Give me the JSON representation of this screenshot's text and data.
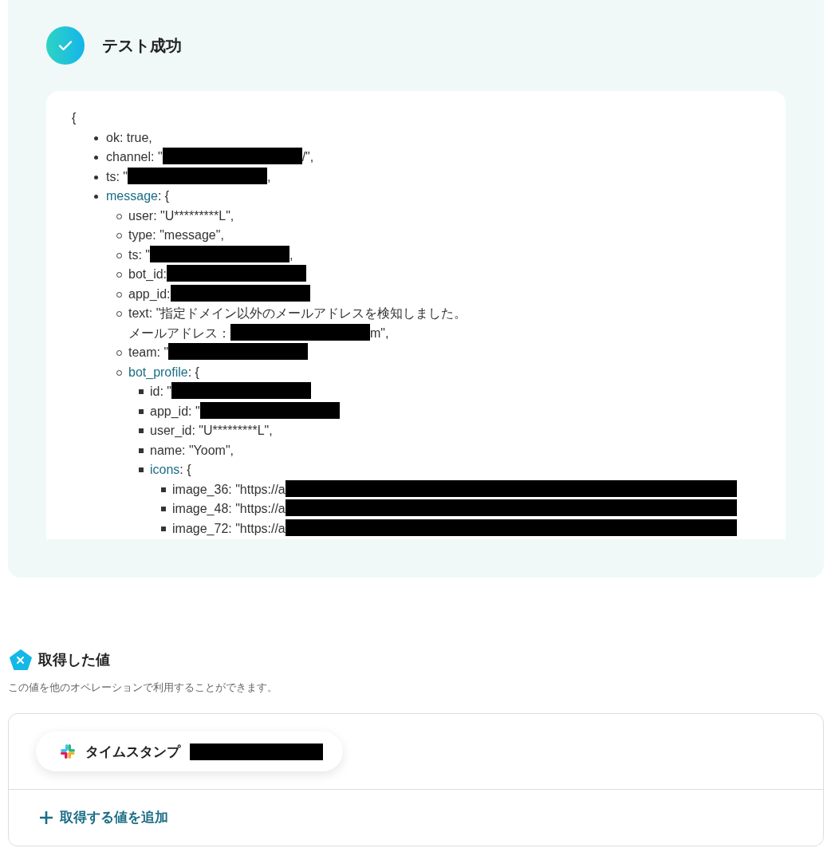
{
  "test_result": {
    "title": "テスト成功"
  },
  "response": {
    "open_brace": "{",
    "items": [
      {
        "kind": "field",
        "text": "ok: true,"
      },
      {
        "kind": "field",
        "text": "channel: \"",
        "redacted": true,
        "after": "/\","
      },
      {
        "kind": "field",
        "text": "ts: \"",
        "redacted": true,
        "after": ","
      },
      {
        "kind": "object",
        "key": "message",
        "suffix": ": {",
        "children": [
          {
            "kind": "field",
            "text": "user: \"U*********L\","
          },
          {
            "kind": "field",
            "text": "type: \"message\","
          },
          {
            "kind": "field",
            "text": "ts: \"",
            "redacted": true,
            "after": ","
          },
          {
            "kind": "field",
            "text": "bot_id: ",
            "redacted": true
          },
          {
            "kind": "field",
            "text": "app_id: ",
            "redacted": true
          },
          {
            "kind": "field",
            "text": "text: \"指定ドメイン以外のメールアドレスを検知しました。",
            "text_continued": "メールアドレス：",
            "redacted": true,
            "after": "m\","
          },
          {
            "kind": "field",
            "text": "team: \"",
            "redacted": true
          },
          {
            "kind": "object",
            "key": "bot_profile",
            "suffix": ": {",
            "children": [
              {
                "kind": "field",
                "text": "id: \"",
                "redacted": true
              },
              {
                "kind": "field",
                "text": "app_id: \"",
                "redacted": true
              },
              {
                "kind": "field",
                "text": "user_id: \"U*********L\","
              },
              {
                "kind": "field",
                "text": "name: \"Yoom\","
              },
              {
                "kind": "object",
                "key": "icons",
                "suffix": ": {",
                "children": [
                  {
                    "kind": "url",
                    "text": "image_36: \"https://a",
                    "redacted": true
                  },
                  {
                    "kind": "url",
                    "text": "image_48: \"https://a",
                    "redacted": true
                  },
                  {
                    "kind": "url",
                    "text": "image_72: \"https://a",
                    "redacted": true
                  }
                ]
              }
            ]
          }
        ]
      }
    ]
  },
  "values": {
    "title": "取得した値",
    "description": "この値を他のオペレーションで利用することができます。",
    "items": [
      {
        "label": "タイムスタンプ",
        "redacted": true
      }
    ],
    "add_button": "取得する値を追加"
  }
}
